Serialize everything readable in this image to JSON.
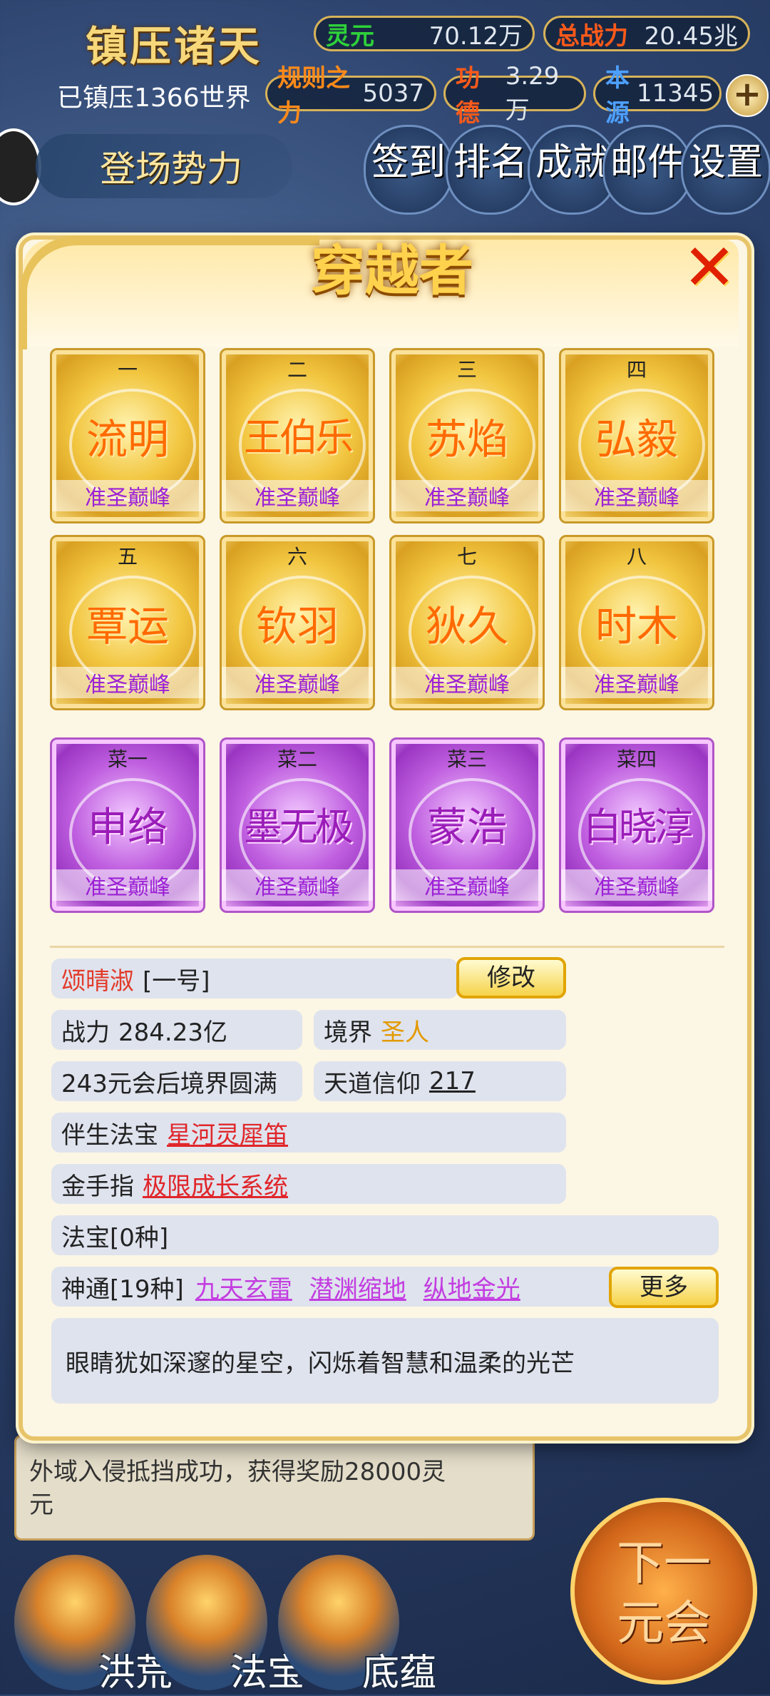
{
  "hud": {
    "title": "镇压诸天",
    "conquered_worlds": "已镇压1366世界",
    "stats": [
      {
        "key": "灵元",
        "value": "70.12万"
      },
      {
        "key": "总战力",
        "value": "20.45兆"
      },
      {
        "key": "规则之力",
        "value": "5037"
      },
      {
        "key": "功德",
        "value": "3.29万"
      },
      {
        "key": "本源",
        "value": "11345"
      }
    ],
    "faction_button": "登场势力",
    "top_buttons": [
      "签到",
      "排名",
      "成就",
      "邮件",
      "设置"
    ]
  },
  "modal": {
    "title": "穿越者",
    "close_icon": "✕"
  },
  "cards": [
    {
      "num": "一",
      "name": "流明",
      "rank": "准圣巅峰",
      "style": "gold"
    },
    {
      "num": "二",
      "name": "王伯乐",
      "rank": "准圣巅峰",
      "style": "gold"
    },
    {
      "num": "三",
      "name": "苏焰",
      "rank": "准圣巅峰",
      "style": "gold"
    },
    {
      "num": "四",
      "name": "弘毅",
      "rank": "准圣巅峰",
      "style": "gold"
    },
    {
      "num": "五",
      "name": "覃运",
      "rank": "准圣巅峰",
      "style": "gold"
    },
    {
      "num": "六",
      "name": "钦羽",
      "rank": "准圣巅峰",
      "style": "gold"
    },
    {
      "num": "七",
      "name": "狄久",
      "rank": "准圣巅峰",
      "style": "gold"
    },
    {
      "num": "八",
      "name": "时木",
      "rank": "准圣巅峰",
      "style": "gold"
    },
    {
      "num": "菜一",
      "name": "申络",
      "rank": "准圣巅峰",
      "style": "purple"
    },
    {
      "num": "菜二",
      "name": "墨无极",
      "rank": "准圣巅峰",
      "style": "purple"
    },
    {
      "num": "菜三",
      "name": "蒙浩",
      "rank": "准圣巅峰",
      "style": "purple"
    },
    {
      "num": "菜四",
      "name": "白晓淳",
      "rank": "准圣巅峰",
      "style": "purple"
    }
  ],
  "detail": {
    "name": "颂晴淑",
    "id_tag": "[一号]",
    "edit_label": "修改",
    "power_label": "战力",
    "power_value": "284.23亿",
    "realm_label": "境界",
    "realm_value": "圣人",
    "perfection": "243元会后境界圆满",
    "faith_label": "天道信仰",
    "faith_value": "217",
    "treasure_label": "伴生法宝",
    "treasure_value": "星河灵犀笛",
    "cheat_label": "金手指",
    "cheat_value": "极限成长系统",
    "artifacts": "法宝[0种]",
    "skills_label": "神通[19种]",
    "skills": [
      "九天玄雷",
      "潜渊缩地",
      "纵地金光"
    ],
    "more_label": "更多",
    "description": "眼睛犹如深邃的星空，闪烁着智慧和温柔的光芒"
  },
  "log": {
    "line1": "外域入侵抵挡成功，获得奖励28000灵",
    "line2": "元"
  },
  "bottom_nav": [
    "洪荒",
    "法宝",
    "底蕴"
  ],
  "next_button": {
    "line1": "下一",
    "line2": "元会"
  }
}
